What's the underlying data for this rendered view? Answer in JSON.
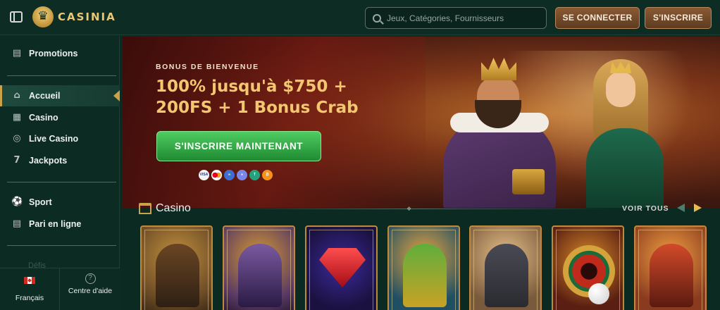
{
  "header": {
    "brand": "CASINIA",
    "search_placeholder": "Jeux, Catégories, Fournisseurs",
    "login_label": "SE CONNECTER",
    "signup_label": "S'INSCRIRE"
  },
  "sidebar": {
    "items": [
      {
        "label": "Promotions",
        "icon": "gift-icon"
      },
      {
        "label": "Accueil",
        "icon": "home-icon",
        "active": true
      },
      {
        "label": "Casino",
        "icon": "casino-icon"
      },
      {
        "label": "Live Casino",
        "icon": "chip-icon"
      },
      {
        "label": "Jackpots",
        "icon": "seven-icon"
      },
      {
        "label": "Sport",
        "icon": "ball-icon"
      },
      {
        "label": "Pari en ligne",
        "icon": "betslip-icon"
      }
    ],
    "faded_item": "Défis",
    "language_label": "Français",
    "help_label": "Centre d'aide"
  },
  "hero": {
    "kicker": "BONUS DE BIENVENUE",
    "title_line1": "100% jusqu'à $750 +",
    "title_line2": "200FS + 1 Bonus Crab",
    "cta_label": "S'INSCRIRE MAINTENANT",
    "payment_methods": [
      "visa",
      "mastercard",
      "interac",
      "ethereum",
      "tether",
      "bitcoin"
    ]
  },
  "casino_section": {
    "title": "Casino",
    "view_all": "VOIR TOUS",
    "games": [
      {
        "icon": "adventurer-thumbnail",
        "bg": "#6b4a26"
      },
      {
        "icon": "magician-thumbnail",
        "bg": "#5a3a66"
      },
      {
        "icon": "ruby-thumbnail",
        "bg": "#1b1140"
      },
      {
        "icon": "fisherman-thumbnail",
        "bg": "#1f4f63"
      },
      {
        "icon": "outlaws-thumbnail",
        "bg": "#7a5a3c"
      },
      {
        "icon": "roulette-thumbnail",
        "bg": "#5a1f12"
      },
      {
        "icon": "party-thumbnail",
        "bg": "#8a3a1f"
      }
    ]
  },
  "colors": {
    "accent_gold": "#c9a24a",
    "cta_green": "#2fae44",
    "sidebar_bg": "#0c2b23"
  }
}
